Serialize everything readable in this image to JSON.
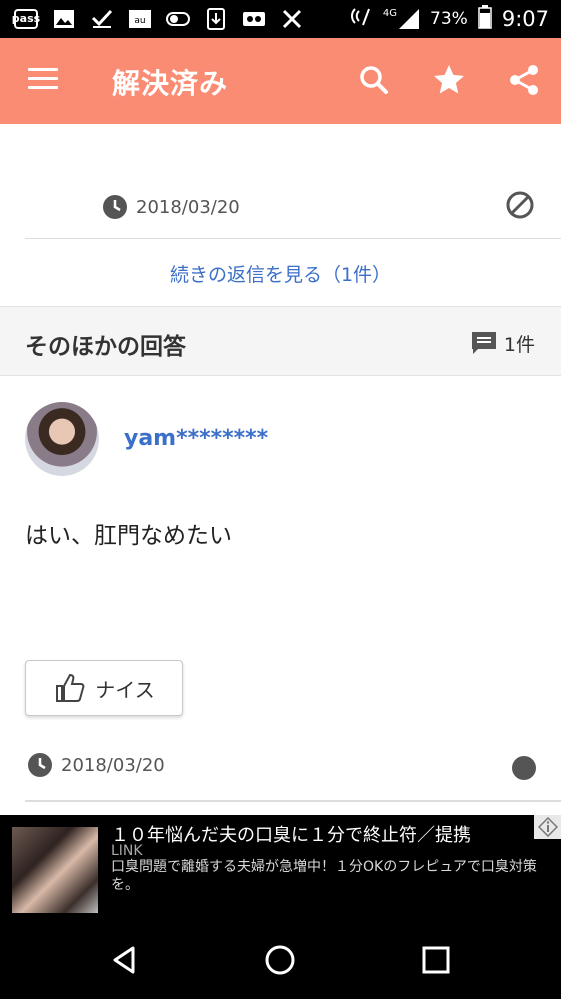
{
  "status_bar": {
    "left_icons": [
      "pass-icon",
      "image-icon",
      "check-icon",
      "au-icon",
      "toggle-icon",
      "download-icon",
      "voicemail-icon",
      "tools-icon"
    ],
    "pass_label": "pass",
    "network": "4G",
    "battery": "73%",
    "time": "9:07"
  },
  "app_bar": {
    "title": "解決済み",
    "colors": {
      "background": "#fb8c74"
    }
  },
  "reply": {
    "date": "2018/03/20",
    "more_replies": "続きの返信を見る（1件）"
  },
  "other_answers": {
    "title": "そのほかの回答",
    "count": "1件"
  },
  "answer": {
    "username": "yam********",
    "text": "はい、肛門なめたい",
    "nice_label": "ナイス",
    "date": "2018/03/20"
  },
  "fab": {
    "colors": {
      "background": "#b57ee0"
    }
  },
  "ad": {
    "title": "１０年悩んだ夫の口臭に１分で終止符／提携",
    "source": "LINK",
    "description": "口臭問題で離婚する夫婦が急増中！１分OKのフレピュアで口臭対策を。"
  }
}
